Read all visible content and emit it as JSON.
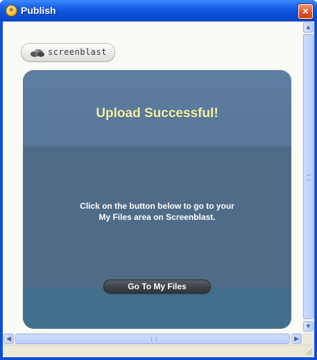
{
  "window": {
    "title": "Publish",
    "close_glyph": "×",
    "icon": "app-icon"
  },
  "logo": {
    "text": "screenblast",
    "icon": "cloud-logo-icon"
  },
  "panel": {
    "headline": "Upload Successful!",
    "message_line1": "Click on the button below to go to your",
    "message_line2": "My Files area on Screenblast.",
    "button_label": "Go To My Files"
  },
  "scrollbars": {
    "up": "▲",
    "down": "▼",
    "left": "◀",
    "right": "▶"
  },
  "colors": {
    "title_bar": "#0b4fd8",
    "panel": "#4f6b87",
    "headline": "#f7f0a6",
    "close_button": "#e0522b"
  }
}
